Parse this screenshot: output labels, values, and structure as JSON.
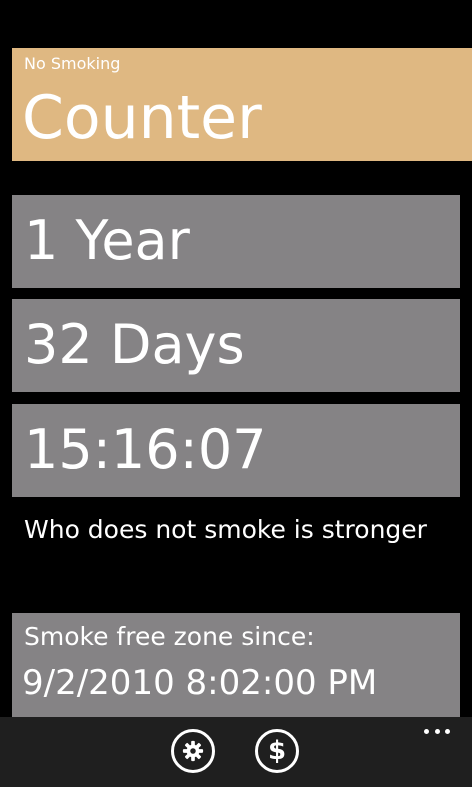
{
  "header": {
    "app_name": "No Smoking",
    "page_title": "Counter"
  },
  "counter": {
    "years": "1 Year",
    "days": "32 Days",
    "time": "15:16:07"
  },
  "motto": "Who does not smoke is stronger",
  "since": {
    "label": "Smoke free zone since:",
    "value": "9/2/2010 8:02:00 PM"
  },
  "appbar": {
    "buttons": [
      {
        "icon": "gear-icon"
      },
      {
        "icon": "dollar-icon",
        "glyph": "$"
      }
    ],
    "more_icon": "ellipsis-icon"
  },
  "colors": {
    "header_background": "#dfb882",
    "tile_background": "#858385",
    "page_background": "#000000",
    "appbar_background": "#1f1f1f"
  }
}
